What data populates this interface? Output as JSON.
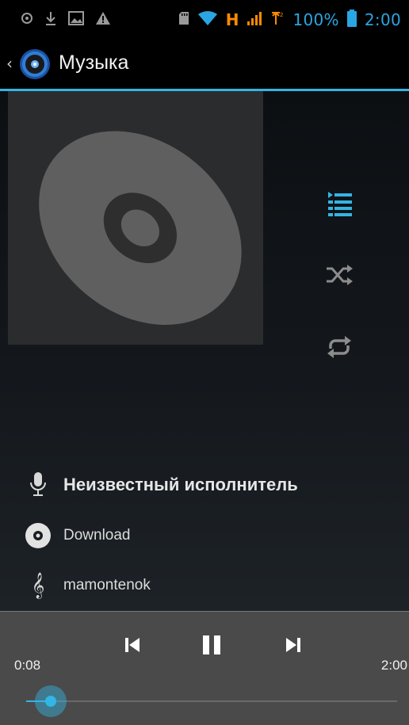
{
  "status_bar": {
    "battery_text": "100%",
    "time": "2:00",
    "network_label": "H",
    "icons": [
      "record-icon",
      "download-icon",
      "image-icon",
      "warning-icon",
      "sdcard-icon",
      "wifi-icon",
      "signal-icon",
      "signal2-icon",
      "battery-icon"
    ]
  },
  "action_bar": {
    "title": "Музыка",
    "icon": "music-disc-icon",
    "back": "‹"
  },
  "controls": {
    "icons": [
      "playlist-icon",
      "shuffle-icon",
      "repeat-icon"
    ],
    "accent_color": "#33b5e5"
  },
  "track": {
    "artist": "Неизвестный исполнитель",
    "album": "Download",
    "title": "mamontenok"
  },
  "player": {
    "current_time": "0:08",
    "total_time": "2:00",
    "progress": 0.067
  }
}
